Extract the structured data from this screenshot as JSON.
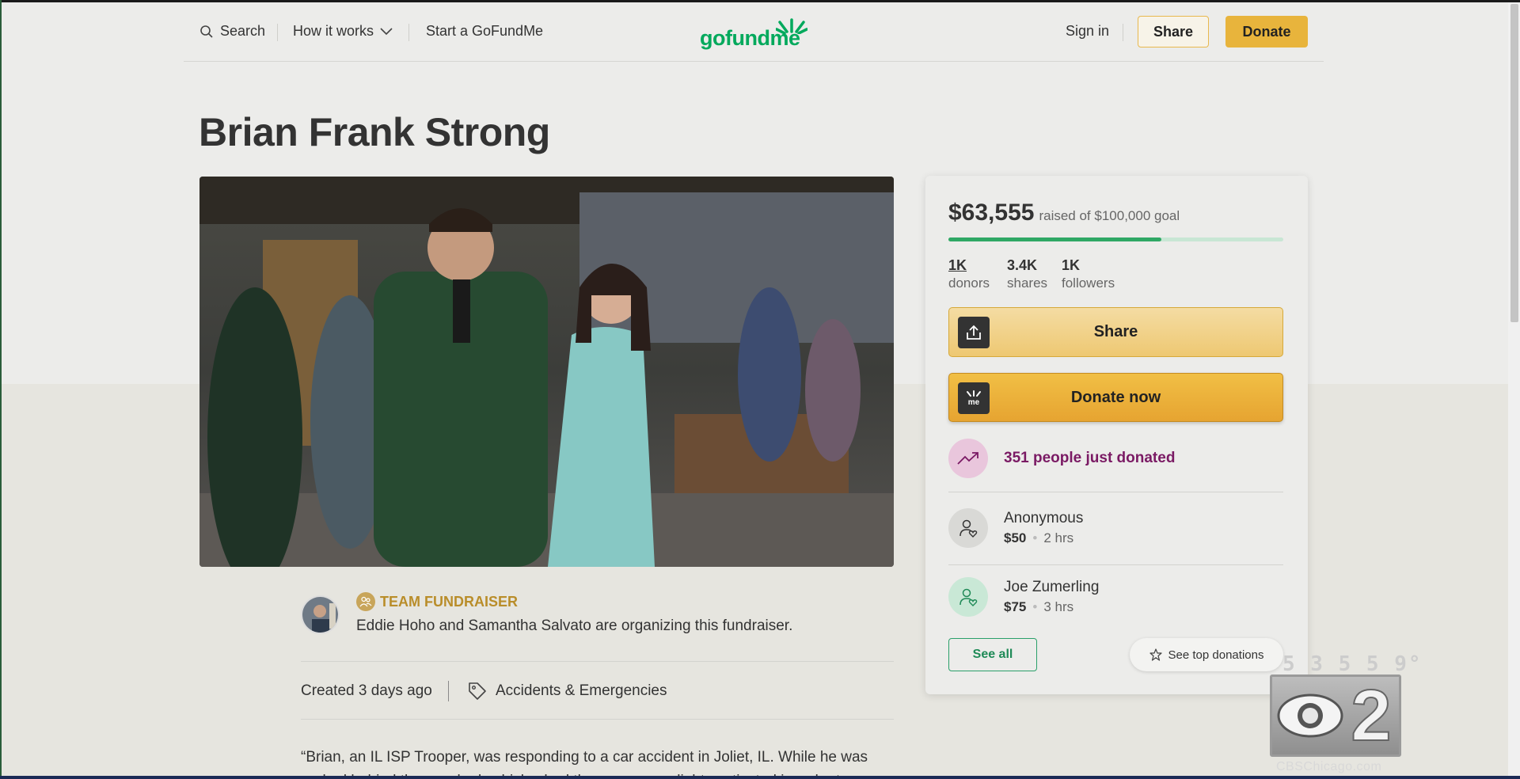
{
  "header": {
    "search_label": "Search",
    "how_it_works_label": "How it works",
    "start_label": "Start a GoFundMe",
    "logo_text": "gofundme",
    "sign_in_label": "Sign in",
    "share_label": "Share",
    "donate_label": "Donate"
  },
  "campaign": {
    "title": "Brian Frank Strong",
    "team_label": "TEAM FUNDRAISER",
    "organizers_text": "Eddie Hoho and Samantha Salvato are organizing this fundraiser.",
    "created": "Created 3 days ago",
    "category": "Accidents & Emergencies",
    "story": "“Brian, an IL ISP Trooper, was responding to a car accident in Joliet, IL. While he was parked behind the wrecked vehicles had the emergency lights activated in order to"
  },
  "sidebar": {
    "raised_amount": "$63,555",
    "raised_goal": "raised of $100,000 goal",
    "progress_percent": 63.6,
    "stats": [
      {
        "value": "1K",
        "label": "donors"
      },
      {
        "value": "3.4K",
        "label": "shares"
      },
      {
        "value": "1K",
        "label": "followers"
      }
    ],
    "share_button": "Share",
    "donate_button": "Donate now",
    "trend_text": "351 people just donated",
    "donations": [
      {
        "name": "Anonymous",
        "amount": "$50",
        "time": "2 hrs"
      },
      {
        "name": "Joe Zumerling",
        "amount": "$75",
        "time": "3 hrs"
      }
    ],
    "see_all_label": "See all",
    "see_top_label": "See top donations"
  },
  "overlay": {
    "temps": "5 3 5   5 9°",
    "site": "CBSChicago.com"
  },
  "colors": {
    "brand_green": "#02a95c",
    "donate_yellow": "#e8b43c",
    "trend_purple": "#7a1a64"
  }
}
